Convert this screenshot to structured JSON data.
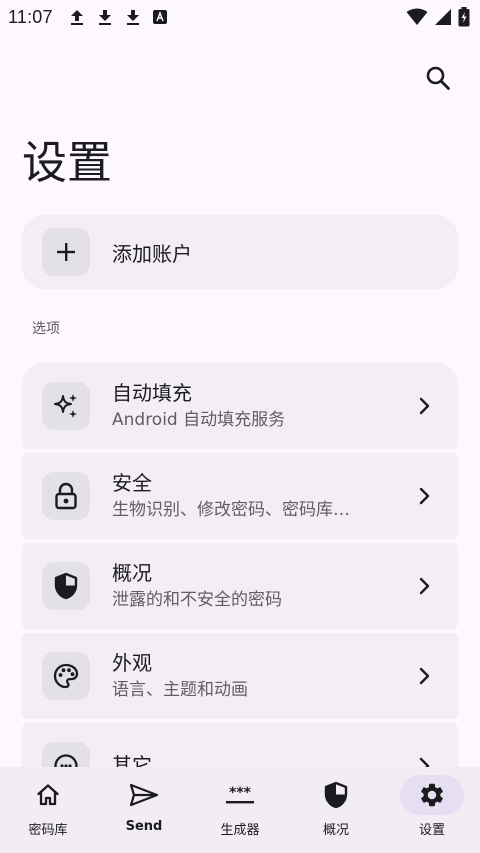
{
  "status_bar": {
    "time": "11:07",
    "left_icons": [
      "upload-icon",
      "download-icon",
      "download-icon",
      "font-icon"
    ],
    "right_icons": [
      "wifi-icon",
      "signal-icon",
      "battery-charging-icon"
    ]
  },
  "header": {
    "search_icon": "search-icon",
    "title": "设置"
  },
  "add_account": {
    "icon": "plus-icon",
    "label": "添加账户"
  },
  "section": {
    "label": "选项"
  },
  "settings": [
    {
      "icon": "sparkle-icon",
      "title": "自动填充",
      "subtitle": "Android 自动填充服务"
    },
    {
      "icon": "lock-icon",
      "title": "安全",
      "subtitle": "生物识别、修改密码、密码库…"
    },
    {
      "icon": "shield-icon",
      "title": "概况",
      "subtitle": "泄露的和不安全的密码"
    },
    {
      "icon": "palette-icon",
      "title": "外观",
      "subtitle": "语言、主题和动画"
    },
    {
      "icon": "info-icon",
      "title": "其它",
      "subtitle": ""
    }
  ],
  "bottom_nav": [
    {
      "icon": "home-icon",
      "label": "密码库",
      "active": false
    },
    {
      "icon": "send-icon",
      "label": "Send",
      "active": false
    },
    {
      "icon": "password-generator-icon",
      "label": "生成器",
      "active": false
    },
    {
      "icon": "shield-icon",
      "label": "概况",
      "active": false
    },
    {
      "icon": "gear-icon",
      "label": "设置",
      "active": true
    }
  ],
  "colors": {
    "background": "#fcf8fd",
    "card": "#f2eef4",
    "icon_box": "#e3e0e7",
    "active_pill": "#e6def3",
    "text_primary": "#1c1b1f",
    "text_secondary": "#605d66"
  }
}
